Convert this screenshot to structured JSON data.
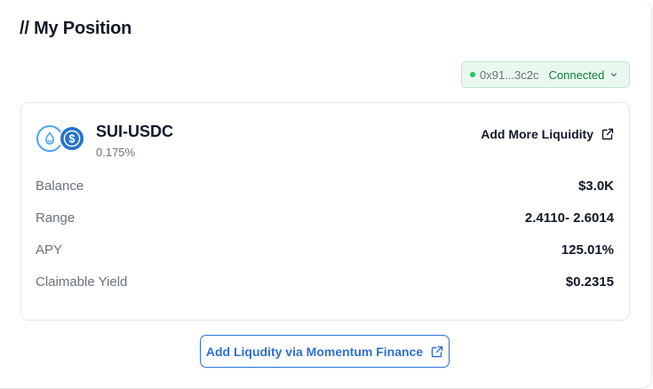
{
  "header": {
    "title": "// My Position"
  },
  "wallet": {
    "address": "0x91...3c2c",
    "status": "Connected",
    "status_color": "#15803d",
    "icons": [
      "status-dot-icon",
      "chevron-down-icon"
    ]
  },
  "position": {
    "pair": "SUI-USDC",
    "fee_tier": "0.175%",
    "token_icons": [
      "sui-token-icon",
      "usdc-token-icon"
    ],
    "add_more_label": "Add More Liquidity",
    "rows": [
      {
        "label": "Balance",
        "value": "$3.0K"
      },
      {
        "label": "Range",
        "value": "2.4110- 2.6014"
      },
      {
        "label": "APY",
        "value": "125.01%"
      },
      {
        "label": "Claimable Yield",
        "value": "$0.2315"
      }
    ]
  },
  "cta": {
    "label": "Add Liqudity via Momentum Finance",
    "icon": "external-link-icon",
    "color": "#2f6fd6"
  }
}
